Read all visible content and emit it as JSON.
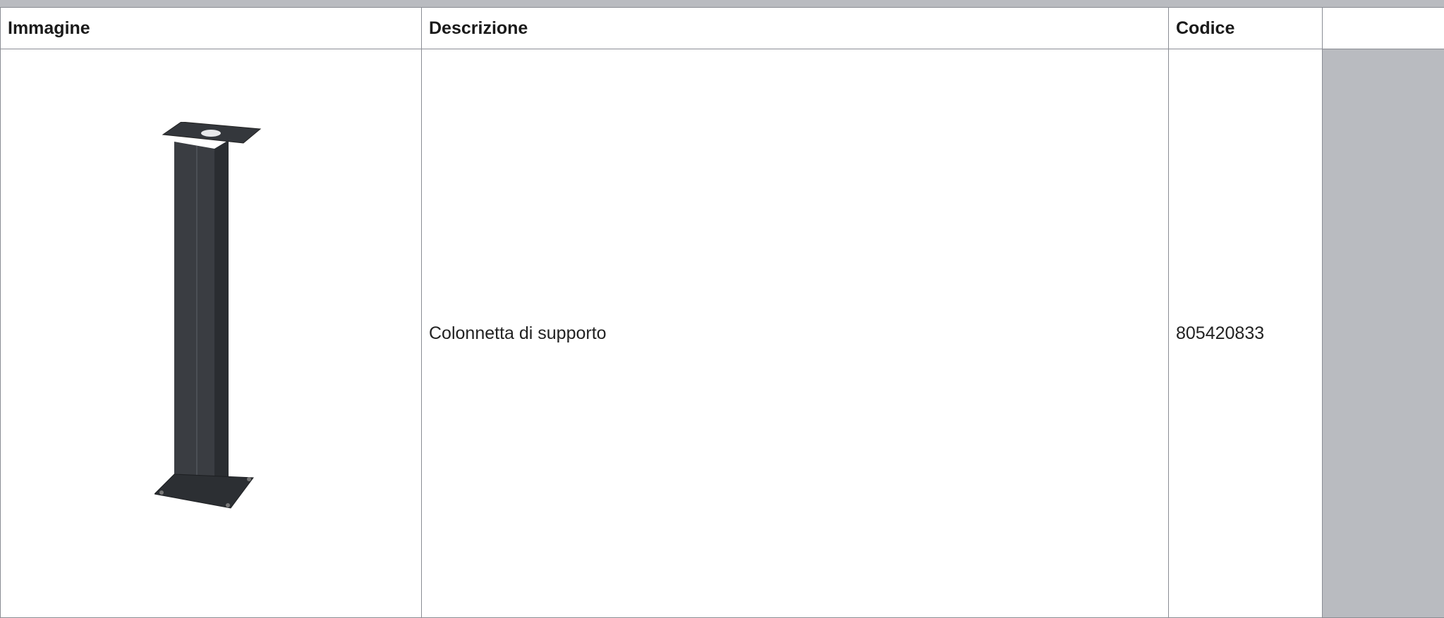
{
  "table": {
    "headers": [
      "Immagine",
      "Descrizione",
      "Codice",
      ""
    ],
    "rows": [
      {
        "image": "support-column-product-image",
        "descrizione": "Colonnetta di supporto",
        "codice": "805420833"
      }
    ]
  },
  "colors": {
    "background_gray": "#b9bbc0",
    "border": "#8a8d94",
    "product_dark": "#2e3135"
  }
}
